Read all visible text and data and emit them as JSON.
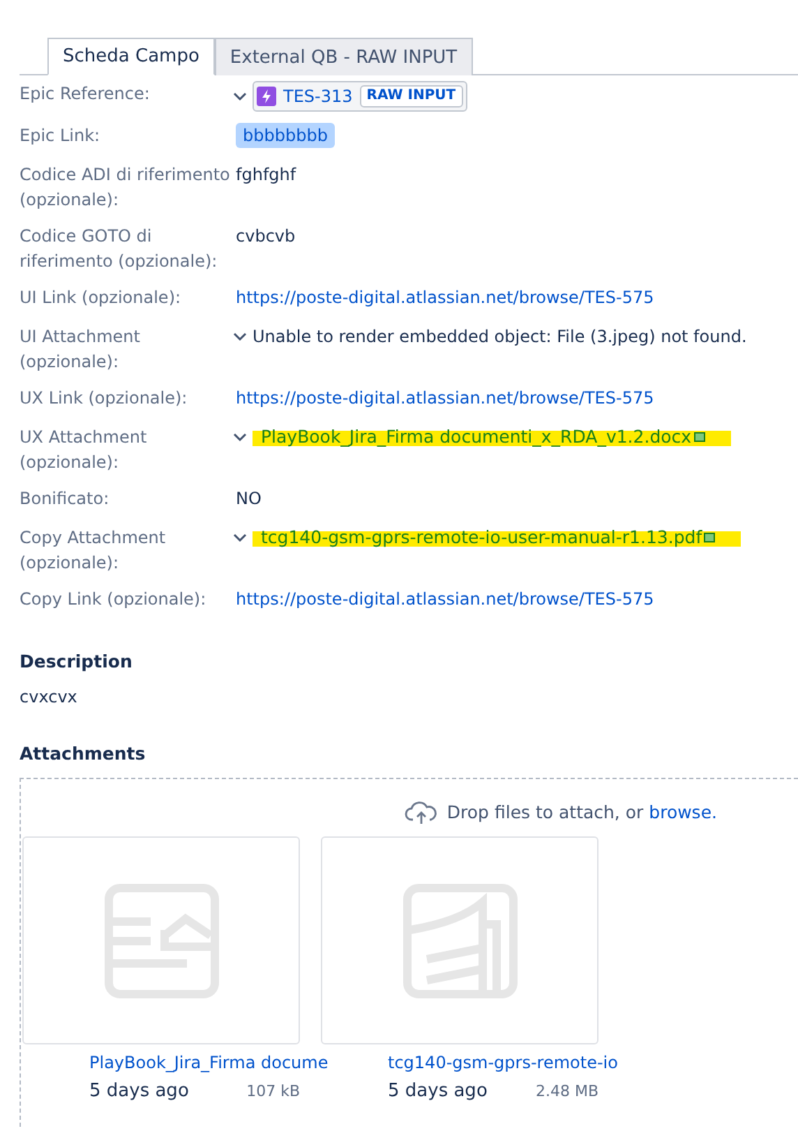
{
  "tabs": [
    {
      "label": "Scheda Campo",
      "selected": true
    },
    {
      "label": "External QB - RAW INPUT",
      "selected": false
    }
  ],
  "fields": [
    {
      "label": "Epic Reference:",
      "kind": "issue",
      "value": "TES-313",
      "badge": "RAW INPUT"
    },
    {
      "label": "Epic Link:",
      "kind": "lozenge",
      "value": "bbbbbbbb"
    },
    {
      "label": "Codice ADI di riferimento (opzionale):",
      "kind": "text",
      "value": "fghfghf"
    },
    {
      "label": "Codice GOTO di riferimento (opzionale):",
      "kind": "text",
      "value": "cvbcvb"
    },
    {
      "label": "UI Link (opzionale):",
      "kind": "link",
      "value": "https://poste-digital.atlassian.net/browse/TES-575"
    },
    {
      "label": "UI Attachment (opzionale):",
      "kind": "error",
      "value": "Unable to render embedded object: File (3.jpeg) not found."
    },
    {
      "label": "UX Link (opzionale):",
      "kind": "link",
      "value": "https://poste-digital.atlassian.net/browse/TES-575"
    },
    {
      "label": "UX Attachment (opzionale):",
      "kind": "attachment",
      "value": "PlayBook_Jira_Firma documenti_x_RDA_v1.2.docx"
    },
    {
      "label": "Bonificato:",
      "kind": "text",
      "value": "NO"
    },
    {
      "label": "Copy Attachment (opzionale):",
      "kind": "attachment",
      "value": "tcg140-gsm-gprs-remote-io-user-manual-r1.13.pdf"
    },
    {
      "label": "Copy Link (opzionale):",
      "kind": "link",
      "value": "https://poste-digital.atlassian.net/browse/TES-575"
    }
  ],
  "description": {
    "heading": "Description",
    "text": "cvxcvx"
  },
  "attachments": {
    "heading": "Attachments",
    "drop_text": "Drop files to attach, or",
    "browse_link": "browse.",
    "files": [
      {
        "kind": "document",
        "name": "PlayBook_Jira_Firma docume",
        "age": "5 days ago",
        "size": "107 kB"
      },
      {
        "kind": "pdf",
        "name": "tcg140-gsm-gprs-remote-io",
        "age": "5 days ago",
        "size": "2.48 MB"
      }
    ]
  }
}
